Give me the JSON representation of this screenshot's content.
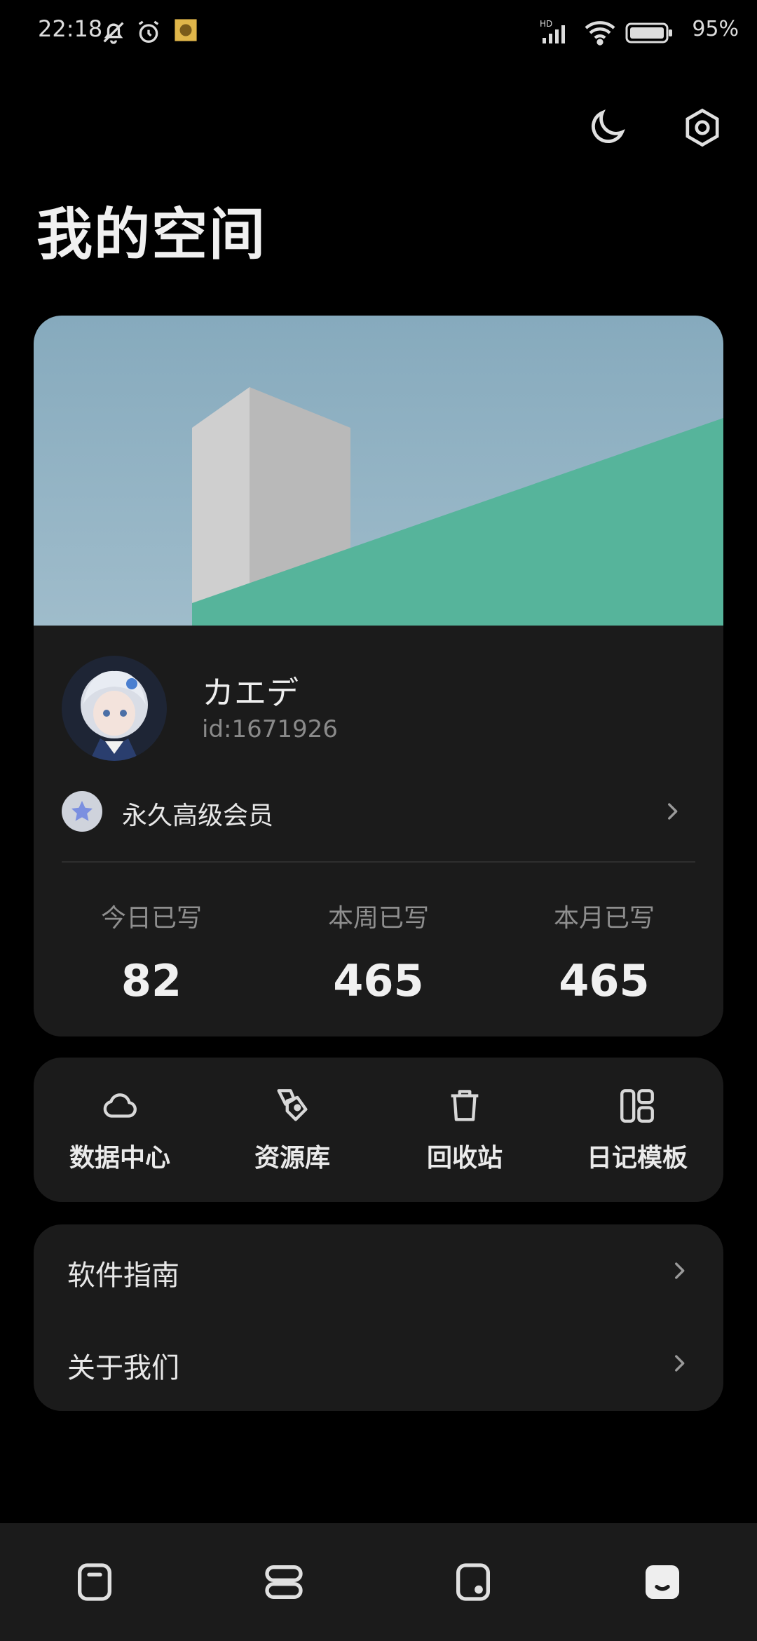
{
  "status_bar": {
    "time": "22:18",
    "battery_percent": "95%",
    "icons": [
      "bell-off-icon",
      "alarm-icon",
      "app-notification-icon",
      "hd-signal-icon",
      "wifi-icon",
      "battery-icon"
    ]
  },
  "header": {
    "title": "我的空间",
    "actions": [
      "night-mode-icon",
      "settings-icon"
    ]
  },
  "profile": {
    "username": "カエデ",
    "user_id": "id:1671926",
    "membership": "永久高级会员",
    "stats": [
      {
        "label": "今日已写",
        "value": "82"
      },
      {
        "label": "本周已写",
        "value": "465"
      },
      {
        "label": "本月已写",
        "value": "465"
      }
    ]
  },
  "tools": [
    {
      "label": "数据中心",
      "icon": "cloud-icon"
    },
    {
      "label": "资源库",
      "icon": "tag-icon"
    },
    {
      "label": "回收站",
      "icon": "trash-icon"
    },
    {
      "label": "日记模板",
      "icon": "template-grid-icon"
    }
  ],
  "menu": [
    {
      "label": "软件指南"
    },
    {
      "label": "关于我们"
    }
  ],
  "bottom_nav": {
    "items": [
      "note-icon",
      "list-icon",
      "square-icon",
      "profile-face-icon"
    ],
    "active": "profile-face-icon"
  },
  "colors": {
    "background": "#000000",
    "card": "#1b1b1b",
    "banner_sky": "#8fb1c2",
    "banner_green": "#56b49b"
  }
}
